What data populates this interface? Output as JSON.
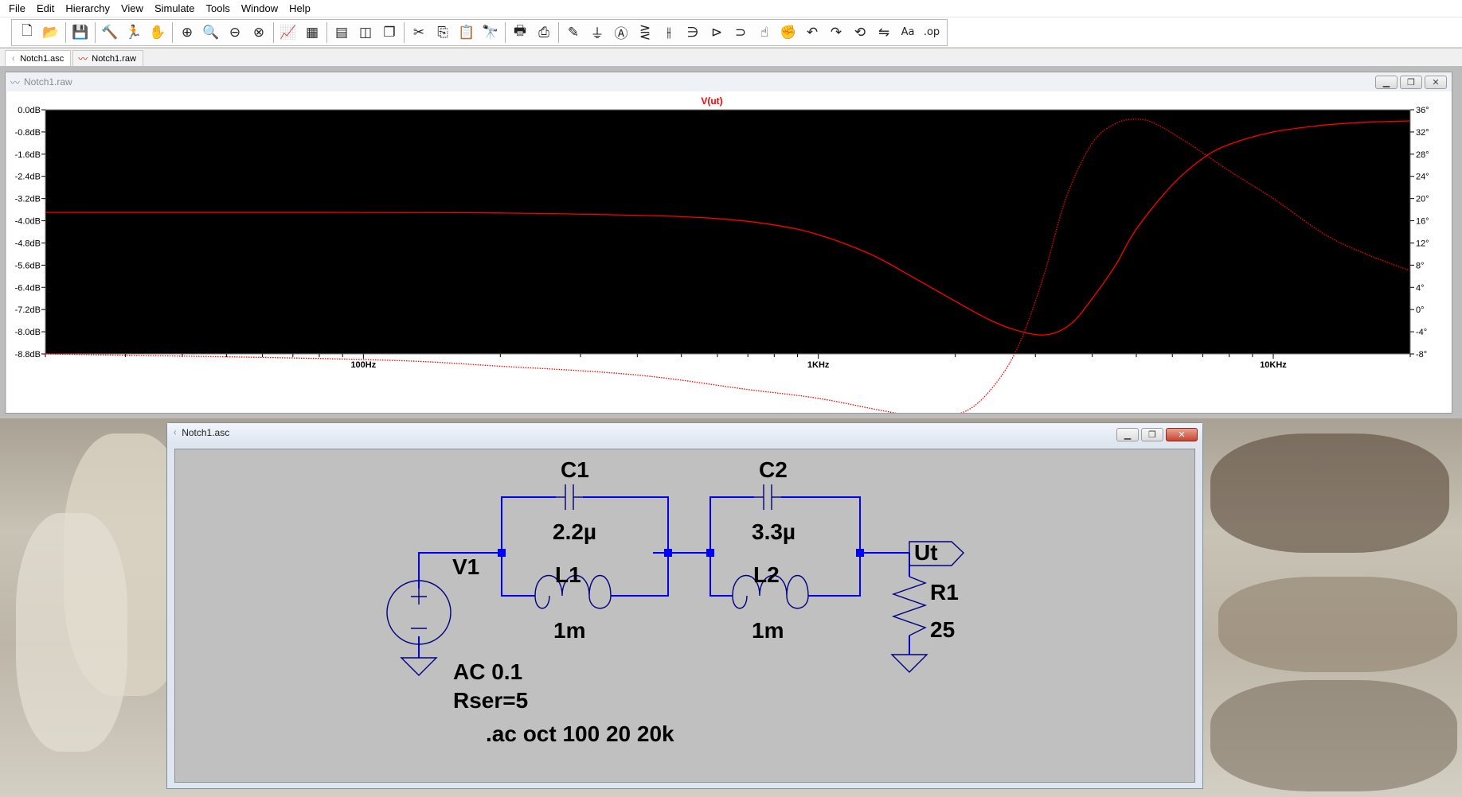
{
  "menu": [
    {
      "label": "File"
    },
    {
      "label": "Edit"
    },
    {
      "label": "Hierarchy"
    },
    {
      "label": "View"
    },
    {
      "label": "Simulate"
    },
    {
      "label": "Tools"
    },
    {
      "label": "Window"
    },
    {
      "label": "Help"
    }
  ],
  "toolbar": {
    "groups": [
      [
        "new-schematic-icon",
        "open-icon"
      ],
      [
        "save-icon"
      ],
      [
        "control-panel-icon",
        "run-icon",
        "pan-icon"
      ],
      [
        "zoom-in-icon",
        "zoom-full-icon",
        "zoom-out-icon",
        "zoom-cancel-icon"
      ],
      [
        "autorange-icon",
        "fft-icon"
      ],
      [
        "tile-horizontal-icon",
        "tile-vertical-icon",
        "cascade-icon"
      ],
      [
        "cut-icon",
        "copy-icon",
        "paste-icon",
        "find-icon"
      ],
      [
        "print-icon",
        "print-setup-icon"
      ],
      [
        "wire-icon",
        "ground-icon",
        "label-net-icon",
        "resistor-icon",
        "capacitor-icon",
        "inductor-icon",
        "diode-icon",
        "component-icon",
        "move-icon",
        "drag-icon",
        "undo-icon",
        "redo-icon",
        "rotate-icon",
        "mirror-icon",
        "text-icon",
        "spice-directive-icon"
      ]
    ],
    "glyphs": {
      "new-schematic-icon": "🗋",
      "open-icon": "📂",
      "save-icon": "💾",
      "control-panel-icon": "🔨",
      "run-icon": "🏃",
      "pan-icon": "✋",
      "zoom-in-icon": "⊕",
      "zoom-full-icon": "🔍",
      "zoom-out-icon": "⊖",
      "zoom-cancel-icon": "⊗",
      "autorange-icon": "📈",
      "fft-icon": "▦",
      "tile-horizontal-icon": "▤",
      "tile-vertical-icon": "◫",
      "cascade-icon": "❐",
      "cut-icon": "✂",
      "copy-icon": "⎘",
      "paste-icon": "📋",
      "find-icon": "🔭",
      "print-icon": "🖶",
      "print-setup-icon": "⎙",
      "wire-icon": "✎",
      "ground-icon": "⏚",
      "label-net-icon": "Ⓐ",
      "resistor-icon": "⋛",
      "capacitor-icon": "⫲",
      "inductor-icon": "∋",
      "diode-icon": "⊳",
      "component-icon": "⊃",
      "move-icon": "☝",
      "drag-icon": "✊",
      "undo-icon": "↶",
      "redo-icon": "↷",
      "rotate-icon": "⟲",
      "mirror-icon": "⇋",
      "text-icon": "Aa",
      "spice-directive-icon": ".op"
    }
  },
  "tabs": [
    {
      "label": "Notch1.asc",
      "icon": "schematic-icon",
      "active": true
    },
    {
      "label": "Notch1.raw",
      "icon": "waveform-icon",
      "active": false
    }
  ],
  "plot_window": {
    "title": "Notch1.raw",
    "controls": [
      "minimize-icon",
      "restore-icon",
      "close-icon"
    ]
  },
  "chart_data": {
    "type": "line",
    "title": "V(ut)",
    "xlabel": "",
    "ylabel": "",
    "xscale": "log",
    "xlim": [
      20,
      20000
    ],
    "x_ticks": [
      {
        "value": 100,
        "label": "100Hz"
      },
      {
        "value": 1000,
        "label": "1KHz"
      },
      {
        "value": 10000,
        "label": "10KHz"
      }
    ],
    "ylim_left": [
      -8.8,
      0.0
    ],
    "y_ticks_left": [
      "0.0dB",
      "-0.8dB",
      "-1.6dB",
      "-2.4dB",
      "-3.2dB",
      "-4.0dB",
      "-4.8dB",
      "-5.6dB",
      "-6.4dB",
      "-7.2dB",
      "-8.0dB",
      "-8.8dB"
    ],
    "ylim_right": [
      -8,
      36
    ],
    "y_ticks_right": [
      "36°",
      "32°",
      "28°",
      "24°",
      "20°",
      "16°",
      "12°",
      "8°",
      "4°",
      "0°",
      "-4°",
      "-8°"
    ],
    "grid": false,
    "background": "#000000",
    "trace_color": "#ff0000",
    "series": [
      {
        "role": "magnitude",
        "axis": "left",
        "style": "solid",
        "x": [
          20,
          100,
          200,
          400,
          600,
          800,
          1000,
          1300,
          1600,
          2000,
          2400,
          2800,
          3200,
          3600,
          4000,
          4500,
          5000,
          6000,
          7000,
          8000,
          10000,
          13000,
          16000,
          20000
        ],
        "y": [
          -3.7,
          -3.7,
          -3.72,
          -3.8,
          -3.92,
          -4.15,
          -4.5,
          -5.2,
          -6.0,
          -6.9,
          -7.6,
          -8.0,
          -8.1,
          -7.7,
          -6.8,
          -5.6,
          -4.3,
          -2.7,
          -1.75,
          -1.25,
          -0.8,
          -0.55,
          -0.45,
          -0.4
        ]
      },
      {
        "role": "phase",
        "axis": "right",
        "style": "dotted",
        "x": [
          20,
          100,
          200,
          400,
          700,
          1000,
          1400,
          1700,
          2000,
          2300,
          2700,
          3100,
          3500,
          4000,
          4500,
          5000,
          5500,
          6500,
          8000,
          10000,
          13000,
          16000,
          20000
        ],
        "y": [
          -8.0,
          -9.0,
          -10.2,
          -11.8,
          -14.4,
          -16.0,
          -18.3,
          -19.3,
          -19.0,
          -16.0,
          -8.0,
          5.0,
          20.0,
          30.0,
          33.5,
          34.3,
          33.5,
          30.0,
          25.0,
          20.0,
          13.5,
          10.0,
          7.0
        ]
      }
    ]
  },
  "schematic_window": {
    "title": "Notch1.asc",
    "controls": [
      "minimize-icon",
      "restore-icon",
      "close-icon"
    ],
    "labels": {
      "c1_name": "C1",
      "c1_value": "2.2µ",
      "c2_name": "C2",
      "c2_value": "3.3µ",
      "l1_name": "L1",
      "l1_value": "1m",
      "l2_name": "L2",
      "l2_value": "1m",
      "v1_name": "V1",
      "v1_value": "AC 0.1",
      "v1_rser": "Rser=5",
      "r1_name": "R1",
      "r1_value": "25",
      "out_label": "Ut",
      "directive": ".ac oct 100 20 20k"
    },
    "wire_color": "#0000ff",
    "junction_color": "#0000ff",
    "background": "#c0c0c0"
  }
}
